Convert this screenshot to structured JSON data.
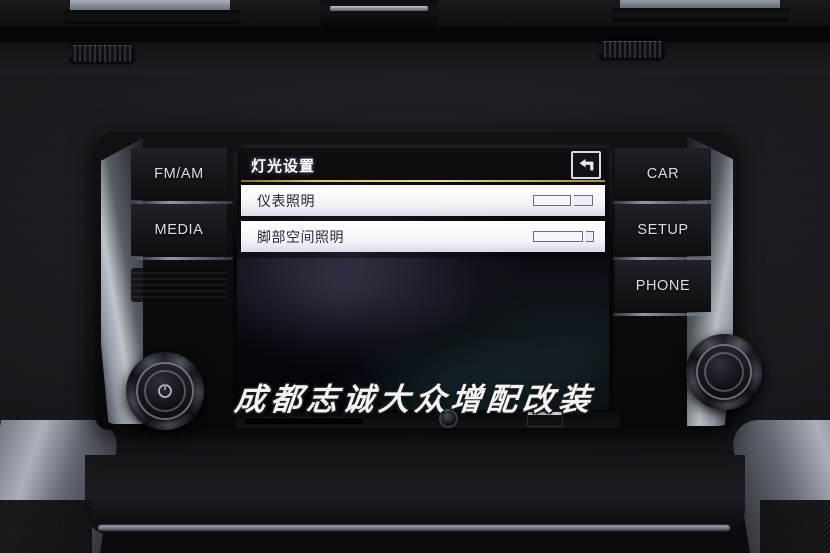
{
  "scene": {
    "description": "Volkswagen car infotainment head unit showing lighting settings menu"
  },
  "watermark": {
    "text": "成都志诚大众增配改装"
  },
  "head_unit": {
    "left_buttons": [
      {
        "label": "FM/AM",
        "name": "fm-am-button"
      },
      {
        "label": "MEDIA",
        "name": "media-button"
      }
    ],
    "right_buttons": [
      {
        "label": "CAR",
        "name": "car-button"
      },
      {
        "label": "SETUP",
        "name": "setup-button"
      },
      {
        "label": "PHONE",
        "name": "phone-button"
      }
    ],
    "left_knob": {
      "icon": "power-icon",
      "label": ""
    },
    "right_knob": {
      "icon": "tune-knob-icon",
      "label": ""
    },
    "ports": {
      "sd_slot": "sd-card-slot",
      "aux_jack": "aux-jack",
      "usb_port": "usb-port"
    }
  },
  "screen": {
    "title": "灯光设置",
    "back_icon": "back-arrow-icon",
    "accent_rule_color": "#e6d898",
    "rows": [
      {
        "label": "仪表照明",
        "slider_fill_pct": 62,
        "stub_pct": 30
      },
      {
        "label": "脚部空间照明",
        "slider_fill_pct": 80,
        "stub_pct": 14
      }
    ]
  },
  "colors": {
    "lcd_background": "#05050a",
    "row_background": "#ffffff",
    "row_text": "#1b1b28",
    "title_text": "#ffffff",
    "button_text": "#dcdee3"
  }
}
